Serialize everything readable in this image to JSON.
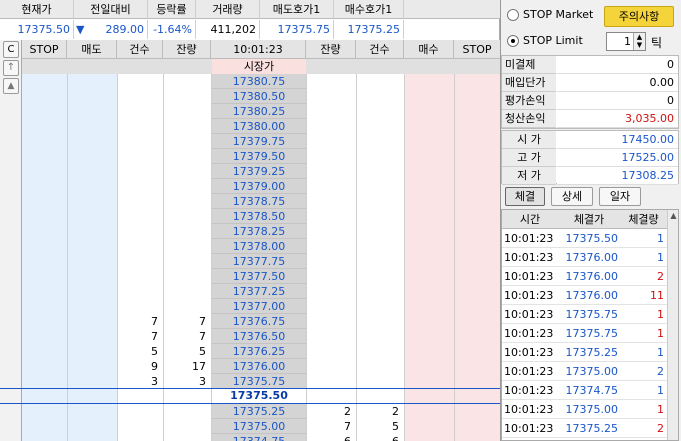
{
  "quote": {
    "headers": [
      "현재가",
      "전일대비",
      "등락률",
      "거래량",
      "매도호가1",
      "매수호가1"
    ],
    "current_price": "17375.50",
    "change_arrow": "▼",
    "change": "289.00",
    "change_rate": "-1.64%",
    "volume": "411,202",
    "ask1": "17375.75",
    "bid1": "17375.25"
  },
  "board": {
    "headers": {
      "stop_left": "STOP",
      "sell": "매도",
      "count_left": "건수",
      "remain_left": "잔량",
      "time": "10:01:23",
      "remain_right": "잔량",
      "count_right": "건수",
      "buy": "매수",
      "stop_right": "STOP"
    },
    "side_buttons": {
      "c": "C",
      "up": "↑",
      "up_tri": "▲"
    },
    "market_label": "시장가",
    "ask_rows": [
      {
        "price": "17380.75",
        "count": "",
        "remain": ""
      },
      {
        "price": "17380.50",
        "count": "",
        "remain": ""
      },
      {
        "price": "17380.25",
        "count": "",
        "remain": ""
      },
      {
        "price": "17380.00",
        "count": "",
        "remain": ""
      },
      {
        "price": "17379.75",
        "count": "",
        "remain": ""
      },
      {
        "price": "17379.50",
        "count": "",
        "remain": ""
      },
      {
        "price": "17379.25",
        "count": "",
        "remain": ""
      },
      {
        "price": "17379.00",
        "count": "",
        "remain": ""
      },
      {
        "price": "17378.75",
        "count": "",
        "remain": ""
      },
      {
        "price": "17378.50",
        "count": "",
        "remain": ""
      },
      {
        "price": "17378.25",
        "count": "",
        "remain": ""
      },
      {
        "price": "17378.00",
        "count": "",
        "remain": ""
      },
      {
        "price": "17377.75",
        "count": "",
        "remain": ""
      },
      {
        "price": "17377.50",
        "count": "",
        "remain": ""
      },
      {
        "price": "17377.25",
        "count": "",
        "remain": ""
      },
      {
        "price": "17377.00",
        "count": "",
        "remain": ""
      },
      {
        "price": "17376.75",
        "count": "7",
        "remain": "7"
      },
      {
        "price": "17376.50",
        "count": "7",
        "remain": "7"
      },
      {
        "price": "17376.25",
        "count": "5",
        "remain": "5"
      },
      {
        "price": "17376.00",
        "count": "9",
        "remain": "17"
      },
      {
        "price": "17375.75",
        "count": "3",
        "remain": "3"
      }
    ],
    "current_row": {
      "price": "17375.50"
    },
    "bid_rows": [
      {
        "price": "17375.25",
        "remain": "2",
        "count": "2"
      },
      {
        "price": "17375.00",
        "remain": "7",
        "count": "5"
      },
      {
        "price": "17374.75",
        "remain": "6",
        "count": "6"
      }
    ]
  },
  "right_panel": {
    "stop_market_label": "STOP Market",
    "stop_limit_label": "STOP Limit",
    "notice_button": "주의사항",
    "tick_value": "1",
    "tick_label": "틱",
    "stats": [
      {
        "label": "미결제",
        "value": "0",
        "color": "#000000"
      },
      {
        "label": "매입단가",
        "value": "0.00",
        "color": "#000000"
      },
      {
        "label": "평가손익",
        "value": "0",
        "color": "#000000"
      },
      {
        "label": "청산손익",
        "value": "3,035.00",
        "color": "#d01010"
      }
    ],
    "prices": [
      {
        "label": "시 가",
        "value": "17450.00"
      },
      {
        "label": "고 가",
        "value": "17525.00"
      },
      {
        "label": "저 가",
        "value": "17308.25"
      }
    ],
    "tabs": [
      "체결",
      "상세",
      "일자"
    ],
    "trade_headers": [
      "시간",
      "체결가",
      "체결량"
    ],
    "trades": [
      {
        "time": "10:01:23",
        "price": "17375.50",
        "qty": "1",
        "qty_color": "#1a56c7"
      },
      {
        "time": "10:01:23",
        "price": "17376.00",
        "qty": "1",
        "qty_color": "#1a56c7"
      },
      {
        "time": "10:01:23",
        "price": "17376.00",
        "qty": "2",
        "qty_color": "#d01010"
      },
      {
        "time": "10:01:23",
        "price": "17376.00",
        "qty": "11",
        "qty_color": "#d01010"
      },
      {
        "time": "10:01:23",
        "price": "17375.75",
        "qty": "1",
        "qty_color": "#d01010"
      },
      {
        "time": "10:01:23",
        "price": "17375.75",
        "qty": "1",
        "qty_color": "#d01010"
      },
      {
        "time": "10:01:23",
        "price": "17375.25",
        "qty": "1",
        "qty_color": "#1a56c7"
      },
      {
        "time": "10:01:23",
        "price": "17375.00",
        "qty": "2",
        "qty_color": "#1a56c7"
      },
      {
        "time": "10:01:23",
        "price": "17374.75",
        "qty": "1",
        "qty_color": "#1a56c7"
      },
      {
        "time": "10:01:23",
        "price": "17375.00",
        "qty": "1",
        "qty_color": "#d01010"
      },
      {
        "time": "10:01:23",
        "price": "17375.25",
        "qty": "2",
        "qty_color": "#d01010"
      }
    ]
  }
}
